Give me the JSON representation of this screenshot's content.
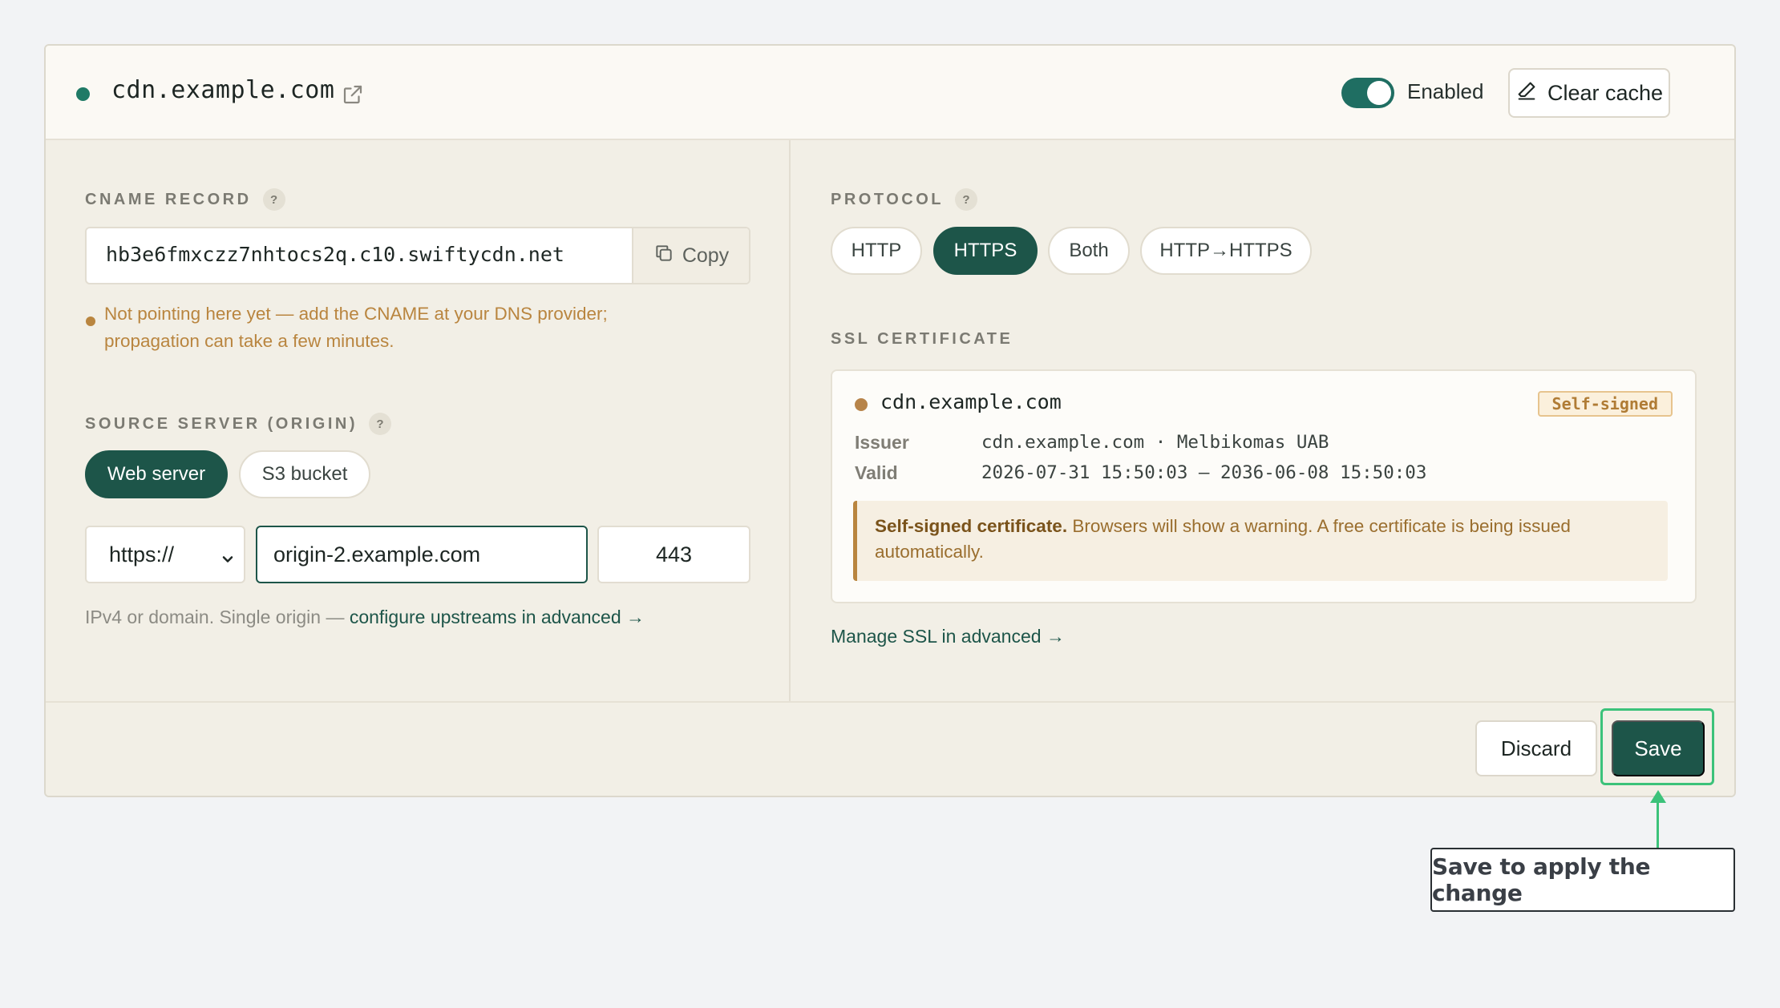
{
  "header": {
    "domain": "cdn.example.com",
    "status_color": "#1f7a66",
    "toggle_label": "Enabled",
    "toggle_on": true,
    "clear_cache_label": "Clear cache",
    "icons": [
      "external-link-icon",
      "eraser-icon"
    ]
  },
  "cname": {
    "label": "CNAME RECORD",
    "help": "?",
    "value": "hb3e6fmxczz7nhtocs2q.c10.swiftycdn.net",
    "copy_label": "Copy",
    "warning": "Not pointing here yet — add the CNAME at your DNS provider; propagation can take a few minutes."
  },
  "origin": {
    "label": "SOURCE SERVER (ORIGIN)",
    "help": "?",
    "types": [
      "Web server",
      "S3 bucket"
    ],
    "active_type": "Web server",
    "scheme": "https://",
    "host": "origin-2.example.com",
    "port": "443",
    "help_text": "IPv4 or domain. Single origin — ",
    "help_link": "configure upstreams in advanced →"
  },
  "protocol": {
    "label": "PROTOCOL",
    "help": "?",
    "options": [
      "HTTP",
      "HTTPS",
      "Both",
      "HTTP→HTTPS"
    ],
    "active": "HTTPS"
  },
  "ssl": {
    "label": "SSL CERTIFICATE",
    "domain": "cdn.example.com",
    "badge": "Self-signed",
    "issuer_key": "Issuer",
    "issuer_value": "cdn.example.com · Melbikomas UAB",
    "valid_key": "Valid",
    "valid_value": "2026-07-31 15:50:03 — 2036-06-08 15:50:03",
    "note_bold": "Self-signed certificate.",
    "note_text": " Browsers will show a warning. A free certificate is being issued automatically.",
    "manage_link": "Manage SSL in advanced →"
  },
  "footer": {
    "discard_label": "Discard",
    "save_label": "Save"
  },
  "callout": {
    "text": "Save to apply the change"
  },
  "colors": {
    "accent": "#1d5549",
    "warning": "#b9853f",
    "highlight": "#3cc27a"
  }
}
